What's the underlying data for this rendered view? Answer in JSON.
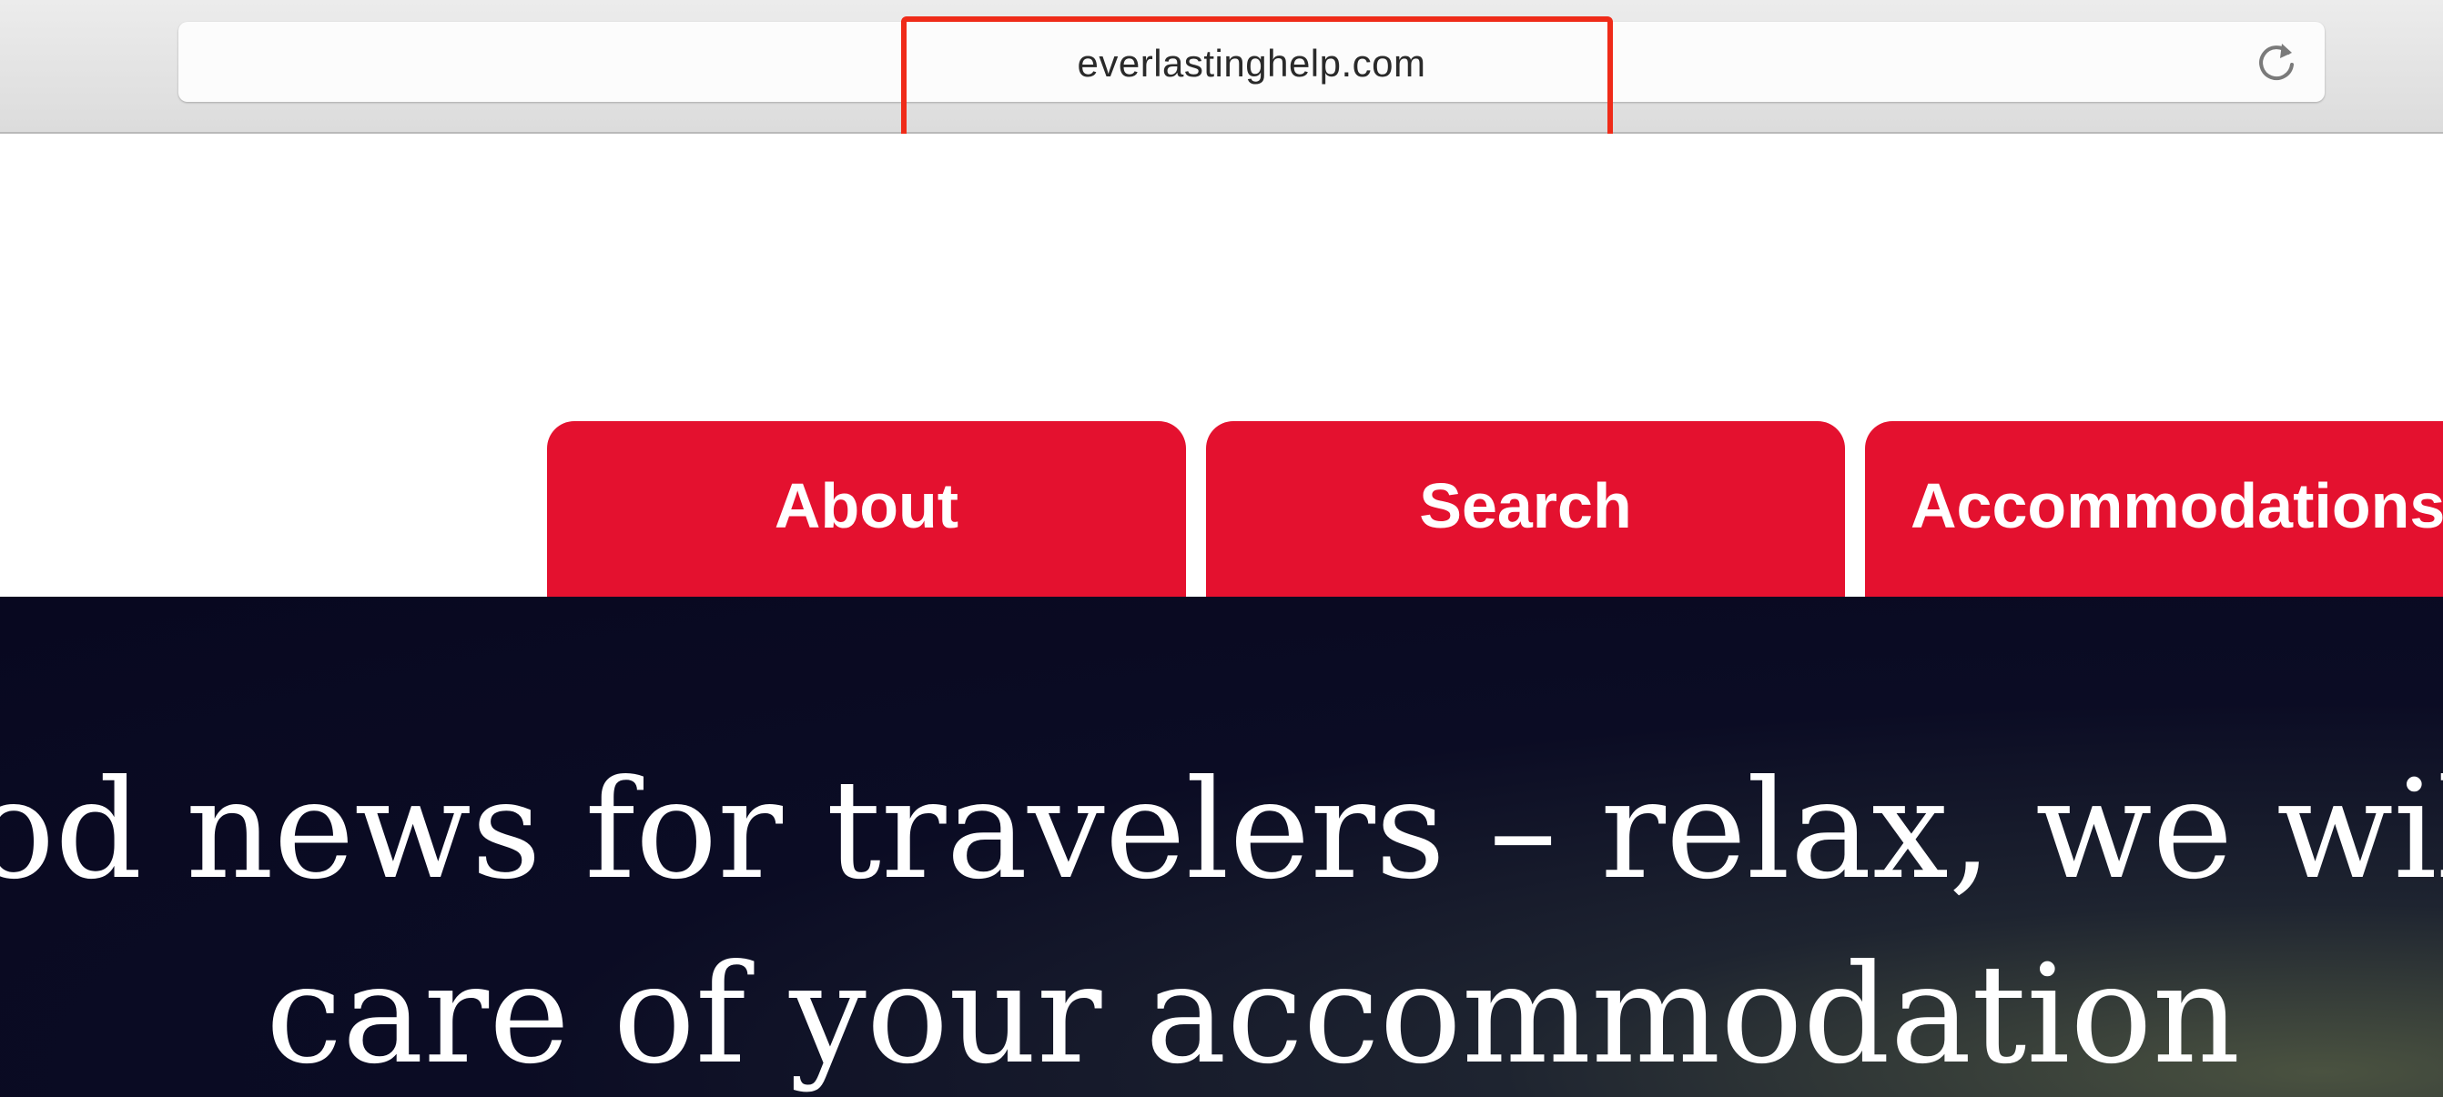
{
  "browser": {
    "url": "everlastinghelp.com",
    "highlight_color": "#ef2b19"
  },
  "nav": {
    "tabs": [
      {
        "label": "About"
      },
      {
        "label": "Search"
      },
      {
        "label": "Accommodations"
      }
    ],
    "tab_color": "#e4112f"
  },
  "hero": {
    "line1": "od news for travelers – relax, we will",
    "line2": "care of  your accommodation"
  }
}
